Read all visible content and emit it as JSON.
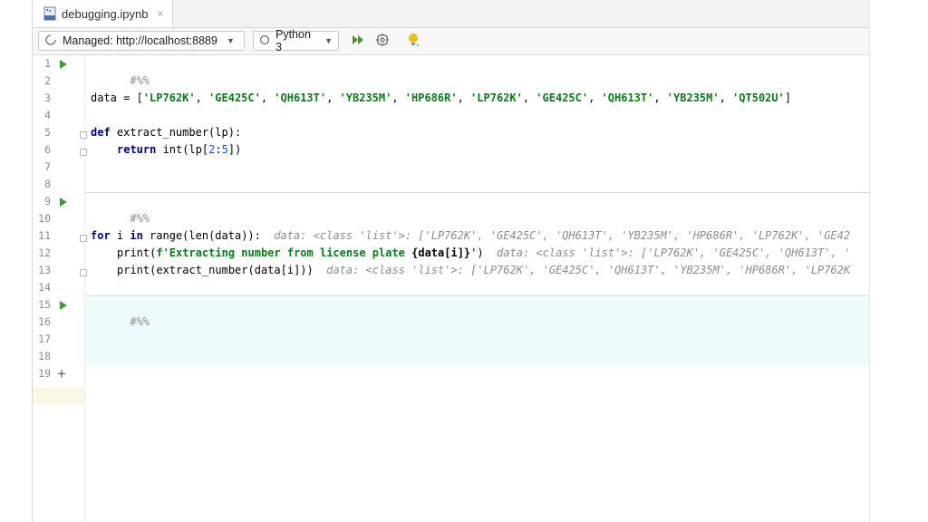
{
  "tab": {
    "filename": "debugging.ipynb",
    "close": "×"
  },
  "toolbar": {
    "server_label": "Managed: http://localhost:8889",
    "kernel_label": "Python 3"
  },
  "lines": {
    "l1": "#%%",
    "l3_a": "data = [",
    "l3_items": [
      "'LP762K'",
      "'GE425C'",
      "'QH613T'",
      "'YB235M'",
      "'HP686R'",
      "'LP762K'",
      "'GE425C'",
      "'QH613T'",
      "'YB235M'",
      "'QT502U'"
    ],
    "l3_sep": ", ",
    "l3_end": "]",
    "l5_kw": "def",
    "l5_rest": " extract_number(lp):",
    "l6_kw": "return",
    "l6_a": " int(lp[",
    "l6_n1": "2",
    "l6_colon": ":",
    "l6_n2": "5",
    "l6_end": "])",
    "l9": "#%%",
    "l11_kw1": "for",
    "l11_a": " i ",
    "l11_kw2": "in",
    "l11_b": " range(len(data)):",
    "l11_inline": "data: <class 'list'>: ['LP762K', 'GE425C', 'QH613T', 'YB235M', 'HP686R', 'LP762K', 'GE42",
    "l12_a": "print(",
    "l12_str": "f'Extracting number from license plate ",
    "l12_fexpr": "{data[i]}",
    "l12_strend": "'",
    "l12_end": ")",
    "l12_inline": "data: <class 'list'>: ['LP762K', 'GE425C', 'QH613T', '",
    "l13_a": "print(extract_number(data[i]))",
    "l13_inline": "data: <class 'list'>: ['LP762K', 'GE425C', 'QH613T', 'YB235M', 'HP686R', 'LP762K",
    "l15": "#%%"
  },
  "line_numbers": [
    "1",
    "2",
    "3",
    "4",
    "5",
    "6",
    "7",
    "8",
    "9",
    "10",
    "11",
    "12",
    "13",
    "14",
    "15",
    "16",
    "17",
    "18",
    "19"
  ],
  "colors": {
    "run_green": "#3d9a3d",
    "keyword": "#000080",
    "string": "#067d17",
    "active_cell": "#eefbfc"
  }
}
